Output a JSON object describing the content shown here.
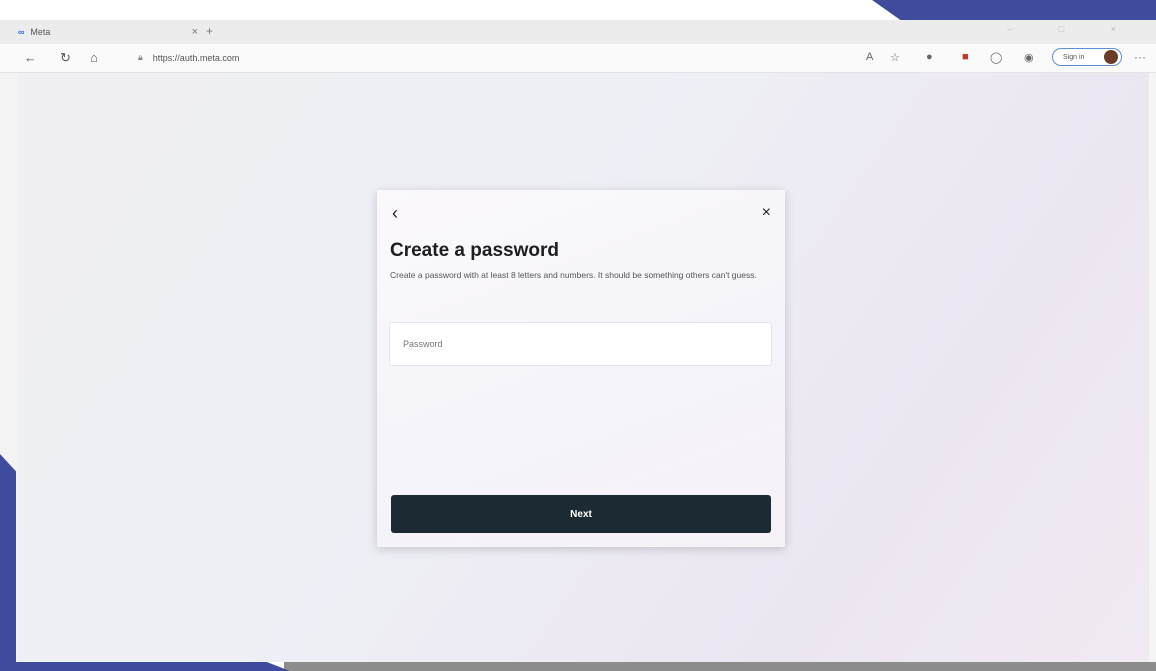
{
  "browser": {
    "tab_title": "Meta",
    "tab_favicon": "∞",
    "tab_close": "×",
    "new_tab": "+",
    "url": "https://auth.meta.com",
    "signin_label": "Sign in",
    "more_label": "···"
  },
  "modal": {
    "back_icon": "‹",
    "close_icon": "×",
    "title": "Create a password",
    "description": "Create a password with at least 8 letters and numbers. It should be something others can't guess.",
    "password_placeholder": "Password",
    "next_label": "Next"
  },
  "colors": {
    "accent_band": "#3f4c9b",
    "button_bg": "#1c2b33"
  }
}
